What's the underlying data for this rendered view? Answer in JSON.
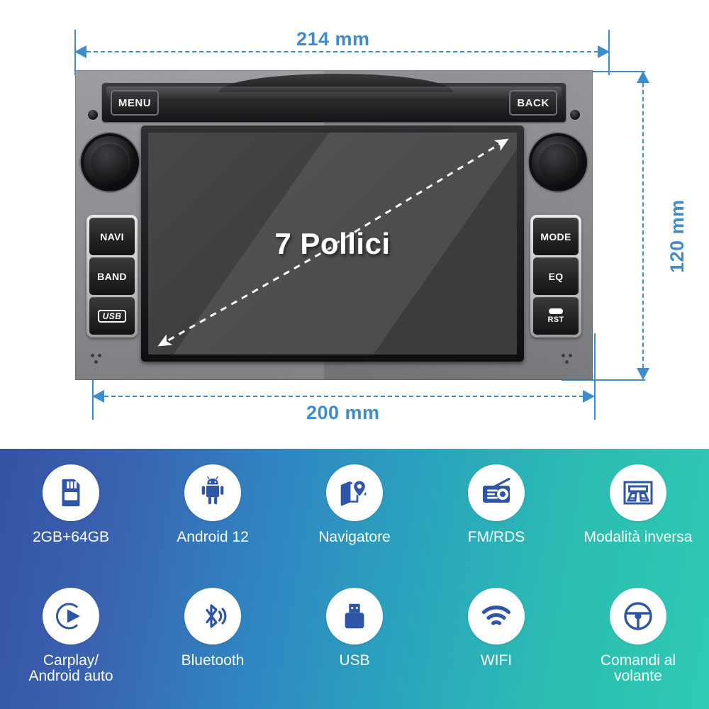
{
  "diagram": {
    "width_top_label": "214 mm",
    "width_bottom_label": "200 mm",
    "height_label": "120 mm"
  },
  "device": {
    "screen_text": "7 Pollici",
    "top_buttons": [
      {
        "label": "MENU",
        "name": "menu"
      },
      {
        "label": "BACK",
        "name": "back"
      }
    ],
    "left_cluster": [
      {
        "label": "NAVI",
        "name": "navi"
      },
      {
        "label": "BAND",
        "name": "band"
      },
      {
        "label": "USB",
        "name": "usb"
      }
    ],
    "right_cluster": [
      {
        "label": "MODE",
        "name": "mode"
      },
      {
        "label": "EQ",
        "name": "eq"
      },
      {
        "label": "RST",
        "name": "rst"
      }
    ]
  },
  "features": {
    "row1": [
      {
        "label": "2GB+64GB",
        "icon": "sd-card-icon"
      },
      {
        "label": "Android 12",
        "icon": "android-icon"
      },
      {
        "label": "Navigatore",
        "icon": "map-pin-icon"
      },
      {
        "label": "FM/RDS",
        "icon": "radio-icon"
      },
      {
        "label": "Modalità inversa",
        "icon": "reverse-camera-icon"
      }
    ],
    "row2": [
      {
        "label": "Carplay/\nAndroid auto",
        "icon": "carplay-icon"
      },
      {
        "label": "Bluetooth",
        "icon": "bluetooth-icon"
      },
      {
        "label": "USB",
        "icon": "usb-icon"
      },
      {
        "label": "WIFI",
        "icon": "wifi-icon"
      },
      {
        "label": "Comandi al\nvolante",
        "icon": "steering-wheel-icon"
      }
    ]
  },
  "colors": {
    "dimension_blue": "#3f8ccb",
    "gradient_start": "#3452a4",
    "gradient_end": "#2ecbb3",
    "icon_blue": "#2f55a7"
  }
}
